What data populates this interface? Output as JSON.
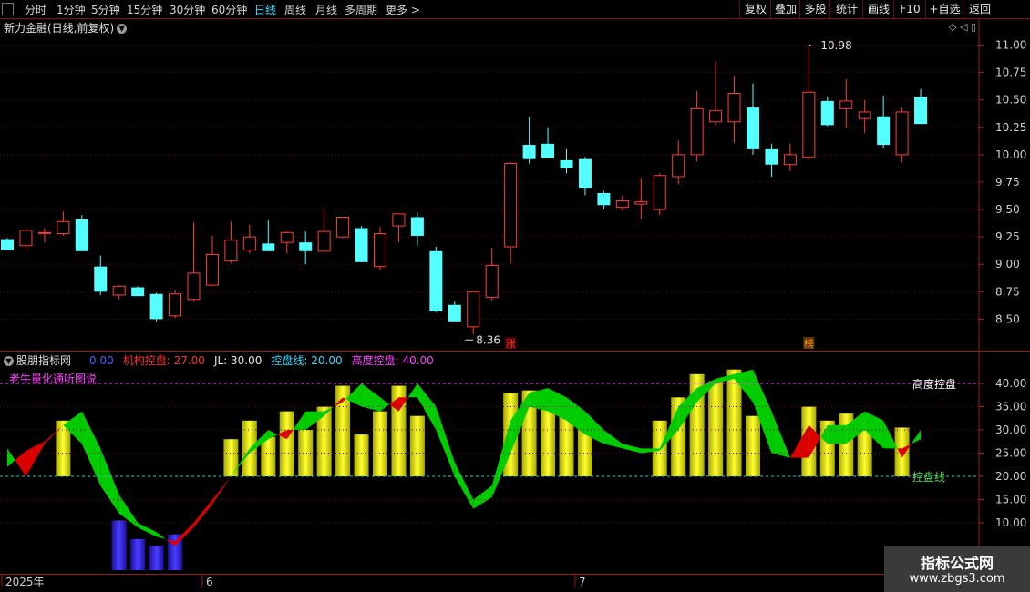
{
  "toolbar": {
    "periods": [
      "分时",
      "1分钟",
      "5分钟",
      "15分钟",
      "30分钟",
      "60分钟",
      "日线",
      "周线",
      "月线",
      "多周期",
      "更多 >"
    ],
    "active_period": "日线",
    "right_buttons": [
      "复权",
      "叠加",
      "多股",
      "统计",
      "画线",
      "F10",
      "+自选",
      "返回"
    ]
  },
  "main_title": "新力金融(日线,前复权)",
  "right_controls": "◇ ◁ ▯",
  "indicator_header": {
    "name": "股朋指标网",
    "items": [
      {
        "text": "0.00",
        "color": "#4f5fff"
      },
      {
        "text": "机构控盘: 27.00",
        "color": "#ff3030"
      },
      {
        "text": "JL: 30.00",
        "color": "#e8e8e8"
      },
      {
        "text": "控盘线: 20.00",
        "color": "#33ddff"
      },
      {
        "text": "高度控盘: 40.00",
        "color": "#ff44ff"
      }
    ]
  },
  "indicator_subtitle": "老牛量化通听图说",
  "watermark": {
    "title": "指标公式网",
    "url": "www.zbgs3.com"
  },
  "colors": {
    "up": "#ff3c3c",
    "down": "#54ffff",
    "bar_yellow": "#ffff00",
    "bar_blue": "#3a2cff",
    "band_red": "#dd0000",
    "band_green": "#00cc00",
    "grid": "#6a0000"
  },
  "chart_data": [
    {
      "type": "candlestick",
      "ylim": [
        8.25,
        11.1
      ],
      "yticks": [
        8.5,
        8.75,
        9.0,
        9.25,
        9.5,
        9.75,
        10.0,
        10.25,
        10.5,
        10.75,
        11.0
      ],
      "x_labels": [
        {
          "i": 0,
          "text": "2025年"
        },
        {
          "i": 11,
          "text": "6"
        },
        {
          "i": 31,
          "text": "7"
        }
      ],
      "annotations": [
        {
          "text": "10.98",
          "i": 43,
          "value": 10.98,
          "kind": "high"
        },
        {
          "text": "8.36",
          "i": 25,
          "value": 8.36,
          "kind": "low"
        },
        {
          "text": "涨",
          "i": 27,
          "kind": "badge",
          "color": "#ff3030"
        },
        {
          "text": "榜",
          "i": 43,
          "kind": "badge",
          "color": "#ff9a00"
        }
      ],
      "candles": [
        {
          "o": 9.23,
          "h": 9.24,
          "l": 9.13,
          "c": 9.13
        },
        {
          "o": 9.17,
          "h": 9.33,
          "l": 9.12,
          "c": 9.31
        },
        {
          "o": 9.29,
          "h": 9.33,
          "l": 9.2,
          "c": 9.29
        },
        {
          "o": 9.28,
          "h": 9.48,
          "l": 9.26,
          "c": 9.39
        },
        {
          "o": 9.41,
          "h": 9.45,
          "l": 9.12,
          "c": 9.12
        },
        {
          "o": 8.98,
          "h": 9.08,
          "l": 8.72,
          "c": 8.75
        },
        {
          "o": 8.72,
          "h": 8.81,
          "l": 8.68,
          "c": 8.8
        },
        {
          "o": 8.79,
          "h": 8.8,
          "l": 8.71,
          "c": 8.71
        },
        {
          "o": 8.73,
          "h": 8.74,
          "l": 8.48,
          "c": 8.5
        },
        {
          "o": 8.53,
          "h": 8.77,
          "l": 8.51,
          "c": 8.73
        },
        {
          "o": 8.68,
          "h": 9.38,
          "l": 8.66,
          "c": 8.92
        },
        {
          "o": 8.81,
          "h": 9.26,
          "l": 8.8,
          "c": 9.09
        },
        {
          "o": 9.03,
          "h": 9.39,
          "l": 9.01,
          "c": 9.22
        },
        {
          "o": 9.13,
          "h": 9.36,
          "l": 9.1,
          "c": 9.25
        },
        {
          "o": 9.19,
          "h": 9.4,
          "l": 9.12,
          "c": 9.12
        },
        {
          "o": 9.2,
          "h": 9.3,
          "l": 9.1,
          "c": 9.29
        },
        {
          "o": 9.2,
          "h": 9.3,
          "l": 9.0,
          "c": 9.12
        },
        {
          "o": 9.12,
          "h": 9.49,
          "l": 9.1,
          "c": 9.3
        },
        {
          "o": 9.25,
          "h": 9.43,
          "l": 9.24,
          "c": 9.43
        },
        {
          "o": 9.33,
          "h": 9.35,
          "l": 9.02,
          "c": 9.02
        },
        {
          "o": 8.98,
          "h": 9.34,
          "l": 8.95,
          "c": 9.28
        },
        {
          "o": 9.35,
          "h": 9.45,
          "l": 9.2,
          "c": 9.46
        },
        {
          "o": 9.43,
          "h": 9.47,
          "l": 9.17,
          "c": 9.26
        },
        {
          "o": 9.12,
          "h": 9.16,
          "l": 8.56,
          "c": 8.57
        },
        {
          "o": 8.63,
          "h": 8.66,
          "l": 8.48,
          "c": 8.48
        },
        {
          "o": 8.43,
          "h": 8.76,
          "l": 8.36,
          "c": 8.75
        },
        {
          "o": 8.7,
          "h": 9.15,
          "l": 8.67,
          "c": 8.99
        },
        {
          "o": 9.16,
          "h": 9.93,
          "l": 9.01,
          "c": 9.92
        },
        {
          "o": 10.09,
          "h": 10.35,
          "l": 9.92,
          "c": 9.96
        },
        {
          "o": 10.1,
          "h": 10.25,
          "l": 9.97,
          "c": 9.97
        },
        {
          "o": 9.95,
          "h": 10.05,
          "l": 9.83,
          "c": 9.88
        },
        {
          "o": 9.96,
          "h": 9.98,
          "l": 9.63,
          "c": 9.7
        },
        {
          "o": 9.65,
          "h": 9.67,
          "l": 9.5,
          "c": 9.54
        },
        {
          "o": 9.52,
          "h": 9.63,
          "l": 9.49,
          "c": 9.58
        },
        {
          "o": 9.55,
          "h": 9.79,
          "l": 9.41,
          "c": 9.57
        },
        {
          "o": 9.5,
          "h": 9.83,
          "l": 9.45,
          "c": 9.81
        },
        {
          "o": 9.8,
          "h": 10.13,
          "l": 9.73,
          "c": 10.0
        },
        {
          "o": 10.0,
          "h": 10.58,
          "l": 9.94,
          "c": 10.42
        },
        {
          "o": 10.3,
          "h": 10.85,
          "l": 10.27,
          "c": 10.4
        },
        {
          "o": 10.3,
          "h": 10.72,
          "l": 10.11,
          "c": 10.56
        },
        {
          "o": 10.43,
          "h": 10.65,
          "l": 10.0,
          "c": 10.05
        },
        {
          "o": 10.05,
          "h": 10.1,
          "l": 9.8,
          "c": 9.91
        },
        {
          "o": 9.91,
          "h": 10.1,
          "l": 9.85,
          "c": 10.0
        },
        {
          "o": 9.98,
          "h": 10.98,
          "l": 9.95,
          "c": 10.57
        },
        {
          "o": 10.49,
          "h": 10.53,
          "l": 10.26,
          "c": 10.27
        },
        {
          "o": 10.42,
          "h": 10.69,
          "l": 10.25,
          "c": 10.49
        },
        {
          "o": 10.33,
          "h": 10.5,
          "l": 10.2,
          "c": 10.39
        },
        {
          "o": 10.35,
          "h": 10.54,
          "l": 10.06,
          "c": 10.09
        },
        {
          "o": 10.0,
          "h": 10.43,
          "l": 9.93,
          "c": 10.39
        },
        {
          "o": 10.53,
          "h": 10.6,
          "l": 10.28,
          "c": 10.28
        }
      ]
    },
    {
      "type": "indicator",
      "ylim": [
        0,
        45
      ],
      "yticks": [
        10,
        15,
        20,
        25,
        30,
        35,
        40
      ],
      "levels": [
        {
          "name": "控盘线",
          "value": 20,
          "label": "控盘线",
          "color": "#33ccbb"
        },
        {
          "name": "高度控盘",
          "value": 40,
          "label": "高度控盘",
          "color": "#ff44ff"
        }
      ],
      "bars": [
        {
          "i": 3,
          "value": 32,
          "color": "yellow"
        },
        {
          "i": 6,
          "value": 10.5,
          "color": "blue"
        },
        {
          "i": 7,
          "value": 6.5,
          "color": "blue"
        },
        {
          "i": 8,
          "value": 5,
          "color": "blue"
        },
        {
          "i": 9,
          "value": 7.5,
          "color": "blue"
        },
        {
          "i": 12,
          "value": 28,
          "color": "yellow"
        },
        {
          "i": 13,
          "value": 32,
          "color": "yellow"
        },
        {
          "i": 14,
          "value": 28.5,
          "color": "yellow"
        },
        {
          "i": 15,
          "value": 34,
          "color": "yellow"
        },
        {
          "i": 16,
          "value": 30,
          "color": "yellow"
        },
        {
          "i": 17,
          "value": 35,
          "color": "yellow"
        },
        {
          "i": 18,
          "value": 39.5,
          "color": "yellow"
        },
        {
          "i": 19,
          "value": 29,
          "color": "yellow"
        },
        {
          "i": 20,
          "value": 34,
          "color": "yellow"
        },
        {
          "i": 21,
          "value": 39.5,
          "color": "yellow"
        },
        {
          "i": 22,
          "value": 33,
          "color": "yellow"
        },
        {
          "i": 27,
          "value": 38,
          "color": "yellow"
        },
        {
          "i": 28,
          "value": 38.5,
          "color": "yellow"
        },
        {
          "i": 29,
          "value": 36,
          "color": "yellow"
        },
        {
          "i": 30,
          "value": 34.5,
          "color": "yellow"
        },
        {
          "i": 31,
          "value": 32,
          "color": "yellow"
        },
        {
          "i": 35,
          "value": 32,
          "color": "yellow"
        },
        {
          "i": 36,
          "value": 37,
          "color": "yellow"
        },
        {
          "i": 37,
          "value": 42,
          "color": "yellow"
        },
        {
          "i": 38,
          "value": 40.5,
          "color": "yellow"
        },
        {
          "i": 39,
          "value": 43,
          "color": "yellow"
        },
        {
          "i": 40,
          "value": 33,
          "color": "yellow"
        },
        {
          "i": 43,
          "value": 35,
          "color": "yellow"
        },
        {
          "i": 44,
          "value": 32,
          "color": "yellow"
        },
        {
          "i": 45,
          "value": 33.5,
          "color": "yellow"
        },
        {
          "i": 46,
          "value": 33,
          "color": "yellow"
        },
        {
          "i": 48,
          "value": 30.5,
          "color": "yellow"
        }
      ],
      "series": [
        {
          "name": "机构控盘",
          "values": [
            22,
            25.5,
            27.5,
            31,
            27,
            18,
            12,
            9,
            7,
            6,
            10,
            15,
            20,
            25,
            28,
            30,
            30,
            33,
            37,
            35,
            34,
            37,
            37,
            30,
            20,
            13,
            15.5,
            25,
            35,
            34,
            32,
            29,
            27,
            26,
            25,
            25.5,
            30,
            36,
            40,
            41,
            36,
            25,
            24,
            31,
            27,
            27,
            30,
            26,
            26,
            28
          ]
        },
        {
          "name": "JL",
          "values": [
            26,
            20,
            27,
            31,
            34,
            26,
            16,
            10,
            8,
            5,
            9,
            14,
            20,
            26,
            30,
            28,
            34,
            34,
            36,
            40,
            37,
            34,
            40,
            35,
            23,
            15,
            18,
            32,
            38,
            39,
            37,
            34,
            30,
            27,
            26,
            26,
            35,
            39,
            41,
            42,
            43,
            34,
            24,
            24,
            31,
            31,
            34,
            32,
            24,
            30
          ]
        }
      ]
    }
  ]
}
